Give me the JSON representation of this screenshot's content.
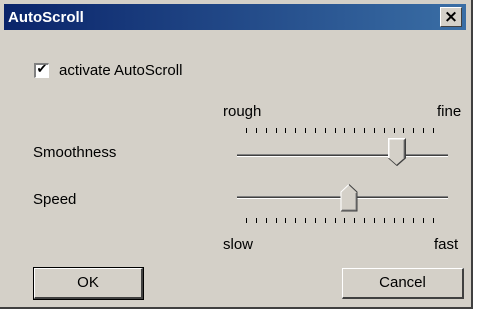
{
  "window": {
    "title": "AutoScroll",
    "close_icon": "close-icon"
  },
  "activate": {
    "label": "activate AutoScroll",
    "checked": true
  },
  "smoothness": {
    "label": "Smoothness",
    "min_label": "rough",
    "max_label": "fine",
    "value_fraction": 0.81
  },
  "speed": {
    "label": "Speed",
    "min_label": "slow",
    "max_label": "fast",
    "value_fraction": 0.55
  },
  "buttons": {
    "ok": "OK",
    "cancel": "Cancel"
  }
}
